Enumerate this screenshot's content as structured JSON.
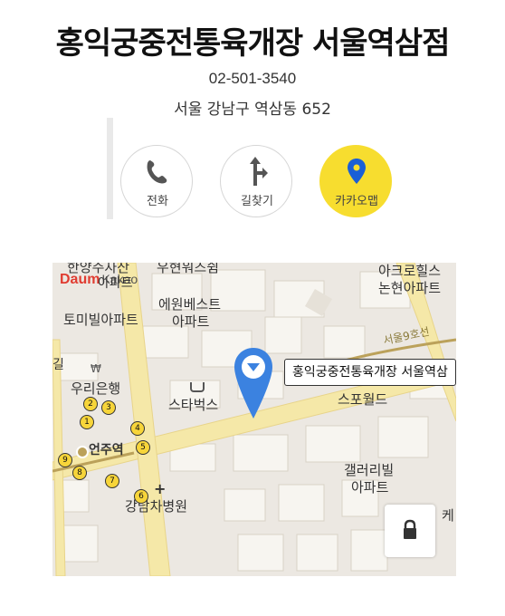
{
  "place": {
    "name": "홍익궁중전통육개장 서울역삼점",
    "phone": "02-501-3540",
    "address": "서울 강남구 역삼동 652"
  },
  "actions": [
    {
      "label": "전화",
      "icon": "phone-icon"
    },
    {
      "label": "길찾기",
      "icon": "directions-icon"
    },
    {
      "label": "카카오맵",
      "icon": "map-pin-icon"
    }
  ],
  "map": {
    "marker_label": "홍익궁중전통육개장 서울역삼",
    "logo_text": "Daum",
    "logo_sub": "Kakao",
    "labels": {
      "hanyang": "한양주자산",
      "uhyeon": "우현워즈쉼",
      "apt_suffix": "아파트",
      "tomibil": "토미빌아파트",
      "ewon": "에원베스트",
      "apt2": "아파트",
      "acro": "아크로힐스",
      "nonhyeon": "논현아파트",
      "line9": "서울9호선",
      "bank": "우리은행",
      "starbucks": "스타벅스",
      "sportworld": "스포월드",
      "gallery": "갤러리빌",
      "apt3": "아파트",
      "station": "언주역",
      "hospital": "강남차병원",
      "edge_ke": "케",
      "edge_gil": "길"
    },
    "exits": [
      "1",
      "2",
      "3",
      "4",
      "5",
      "6",
      "7",
      "8",
      "9"
    ],
    "colors": {
      "road_major": "#f5e8a8",
      "road_edge": "#e8d48a",
      "block": "#f7f5f0",
      "block_stroke": "#d8d2c6",
      "line9": "#bba15a",
      "marker": "#3b82e0",
      "exit_badge": "#f7d53a"
    }
  },
  "lock_icon": "lock-icon"
}
